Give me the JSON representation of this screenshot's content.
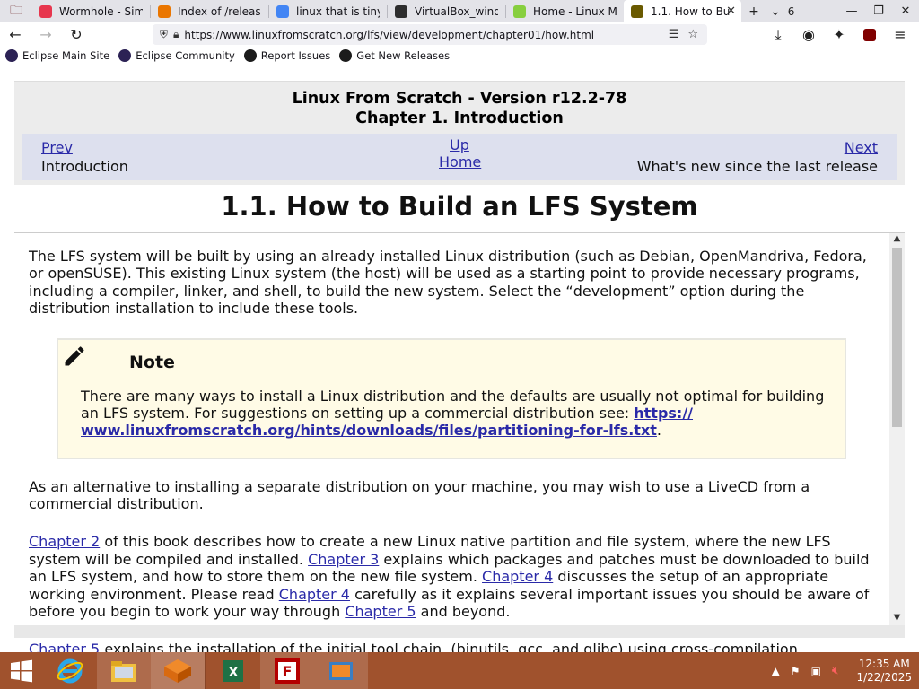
{
  "browser": {
    "tabs": [
      {
        "title": "Wormhole - Simp",
        "icon": "wormhole-icon",
        "color": "#e7364e",
        "active": false
      },
      {
        "title": "Index of /release/",
        "icon": "blender-icon",
        "color": "#ea7600",
        "active": false
      },
      {
        "title": "linux that is tiny -",
        "icon": "google-icon",
        "color": "#4285f4",
        "active": false
      },
      {
        "title": "VirtualBox_windc",
        "icon": "image-icon",
        "color": "#2d2d2d",
        "active": false
      },
      {
        "title": "Home - Linux Mi",
        "icon": "linuxmint-icon",
        "color": "#87cf3e",
        "active": false
      },
      {
        "title": "1.1. How to Bu",
        "icon": "lfs-icon",
        "color": "#6a5a00",
        "active": true
      }
    ],
    "tab_count": "6",
    "url": "https://www.linuxfromscratch.org/lfs/view/development/chapter01/how.html",
    "bookmarks": [
      {
        "label": "Eclipse Main Site",
        "icon": "eclipse-icon"
      },
      {
        "label": "Eclipse Community",
        "icon": "eclipse-icon"
      },
      {
        "label": "Report Issues",
        "icon": "github-icon"
      },
      {
        "label": "Get New Releases",
        "icon": "github-icon"
      }
    ]
  },
  "page": {
    "book_title": "Linux From Scratch - Version r12.2-78",
    "chapter_title": "Chapter 1. Introduction",
    "nav": {
      "prev_label": "Prev",
      "prev_title": "Introduction",
      "up_label": "Up",
      "home_label": "Home",
      "next_label": "Next",
      "next_title": "What's new since the last release"
    },
    "section_title": "1.1. How to Build an LFS System",
    "para1": "The LFS system will be built by using an already installed Linux distribution (such as Debian, OpenMandriva, Fedora, or openSUSE). This existing Linux system (the host) will be used as a starting point to provide necessary programs, including a compiler, linker, and shell, to build the new system. Select the “development” option during the distribution installation to include these tools.",
    "note": {
      "title": "Note",
      "body": "There are many ways to install a Linux distribution and the defaults are usually not optimal for building an LFS system. For suggestions on setting up a commercial distribution see: ",
      "link": "https:// www.linuxfromscratch.org/hints/downloads/files/partitioning-for-lfs.txt",
      "tail": "."
    },
    "para2": "As an alternative to installing a separate distribution on your machine, you may wish to use a LiveCD from a commercial distribution.",
    "para3": {
      "l1": "Chapter 2",
      "t1": " of this book describes how to create a new Linux native partition and file system, where the new LFS system will be compiled and installed. ",
      "l2": "Chapter 3",
      "t2": " explains which packages and patches must be downloaded to build an LFS system, and how to store them on the new file system. ",
      "l3": "Chapter 4",
      "t3": " discusses the setup of an appropriate working environment. Please read ",
      "l4": "Chapter 4",
      "t4": " carefully as it explains several important issues you should be aware of before you begin to work your way through ",
      "l5": "Chapter 5",
      "t5": " and beyond."
    },
    "para4": {
      "l1": "Chapter 5",
      "t1": " explains the installation of the initial tool chain, (binutils, gcc, and glibc) using cross-compilation"
    }
  },
  "taskbar": {
    "items": [
      "start-icon",
      "internet-explorer-icon",
      "file-explorer-icon",
      "virtualbox-icon",
      "excel-icon",
      "filezilla-icon",
      "app-icon"
    ],
    "clock_time": "12:35 AM",
    "clock_date": "1/22/2025"
  }
}
